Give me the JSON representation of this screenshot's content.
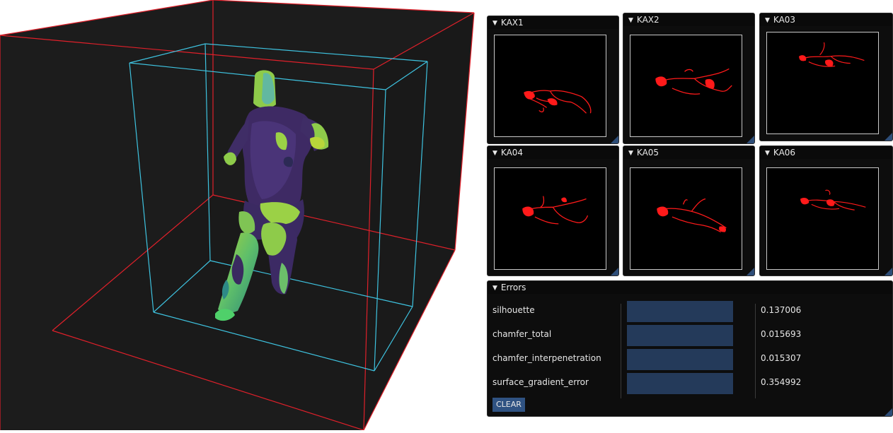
{
  "cameras": [
    {
      "name": "KAX1"
    },
    {
      "name": "KAX2"
    },
    {
      "name": "KA03"
    },
    {
      "name": "KA04"
    },
    {
      "name": "KA05"
    },
    {
      "name": "KA06"
    }
  ],
  "errors": {
    "title": "Errors",
    "rows": [
      {
        "label": "silhouette",
        "value": "0.137006"
      },
      {
        "label": "chamfer_total",
        "value": "0.015693"
      },
      {
        "label": "chamfer_interpenetration",
        "value": "0.015307"
      },
      {
        "label": "surface_gradient_error",
        "value": "0.354992"
      }
    ],
    "clear_label": "CLEAR"
  },
  "colors": {
    "outer_bbox": "#e0202a",
    "inner_bbox": "#3ec3e0",
    "silhouette": "#ff1a1a",
    "bar": "#243a5a",
    "button": "#2f5282"
  }
}
